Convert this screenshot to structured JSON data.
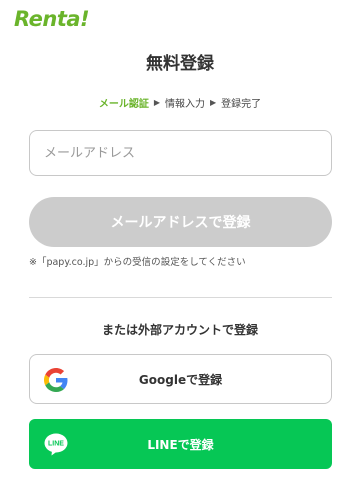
{
  "header": {
    "logo_text": "Renta!"
  },
  "page": {
    "title": "無料登録"
  },
  "steps": [
    {
      "label": "メール認証",
      "active": true
    },
    {
      "label": "情報入力",
      "active": false
    },
    {
      "label": "登録完了",
      "active": false
    }
  ],
  "form": {
    "email_placeholder": "メールアドレス",
    "email_value": "",
    "submit_label": "メールアドレスで登録",
    "note": "※「papy.co.jp」からの受信の設定をしてください"
  },
  "alternatives": {
    "title": "または外部アカウントで登録",
    "google_label": "Googleで登録",
    "line_label": "LINEで登録",
    "line_icon_text": "LINE"
  },
  "colors": {
    "brand_green": "#6ab42b",
    "line_green": "#06c755",
    "disabled_button": "#cccccc"
  },
  "icons": {
    "logo": "renta-logo-icon",
    "google": "google-icon",
    "line": "line-icon"
  }
}
